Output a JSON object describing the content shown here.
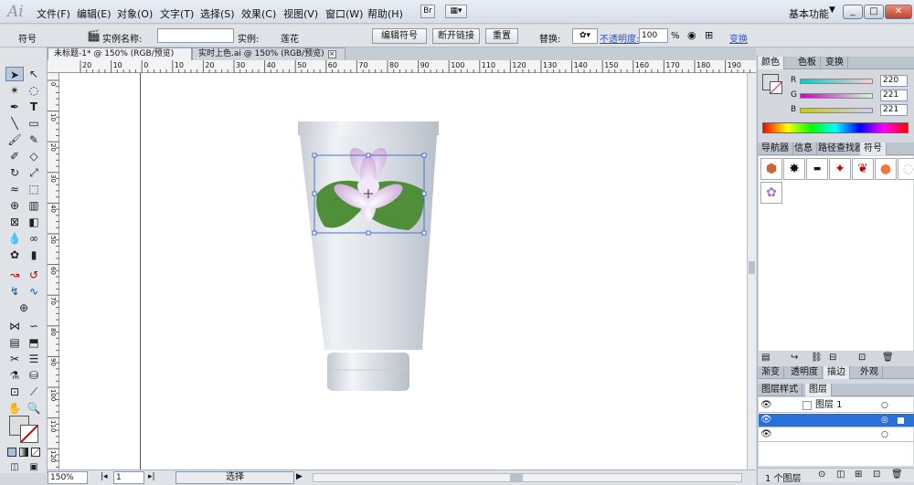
{
  "app": {
    "logo": "Ai"
  },
  "menu": [
    "文件(F)",
    "编辑(E)",
    "对象(O)",
    "文字(T)",
    "选择(S)",
    "效果(C)",
    "视图(V)",
    "窗口(W)",
    "帮助(H)"
  ],
  "menubar_buttons": {
    "bridge": "Br"
  },
  "workspace": {
    "label": "基本功能"
  },
  "control": {
    "panel_label": "符号",
    "instance_name_label": "实例名称:",
    "instance_label": "实例:",
    "instance_value": "莲花",
    "edit_symbol": "编辑符号",
    "break_link": "断开链接",
    "reset": "重置",
    "replace_label": "替换:",
    "opacity_label": "不透明度:",
    "opacity_value": "100",
    "opacity_unit": "%",
    "transform_label": "变换"
  },
  "doc_tabs": [
    {
      "label": "未标题-1* @ 150% (RGB/预览)"
    },
    {
      "label": "实时上色.ai @ 150% (RGB/预览)"
    }
  ],
  "ruler": {
    "h_labels": [
      "20",
      "10",
      "0",
      "10",
      "20",
      "30",
      "40",
      "50",
      "60",
      "70",
      "80",
      "90",
      "100",
      "110",
      "120",
      "130",
      "140",
      "150",
      "160",
      "170",
      "180",
      "190"
    ],
    "v_labels": [
      "0",
      "10",
      "20",
      "30",
      "40",
      "50",
      "60",
      "70",
      "80",
      "90",
      "100",
      "110",
      "120"
    ]
  },
  "status": {
    "zoom": "150%",
    "page": "1",
    "tool": "选择"
  },
  "color_panel": {
    "tabs": [
      "颜色",
      "色板",
      "变换"
    ],
    "r": {
      "label": "R",
      "value": "220"
    },
    "g": {
      "label": "G",
      "value": "221"
    },
    "b": {
      "label": "B",
      "value": "221"
    },
    "fill_color": "#dcdddd"
  },
  "symbols_panel": {
    "tabs": [
      "导航器",
      "信息",
      "路径查找器",
      "符号"
    ]
  },
  "appearance_panel": {
    "tabs": [
      "渐变",
      "透明度",
      "描边",
      "外观"
    ]
  },
  "layers_panel": {
    "tabs": [
      "图层样式",
      "图层"
    ],
    "rows": [
      {
        "label": "图层 1"
      },
      {
        "label": ""
      },
      {
        "label": ""
      }
    ],
    "count": "1 个图层"
  }
}
